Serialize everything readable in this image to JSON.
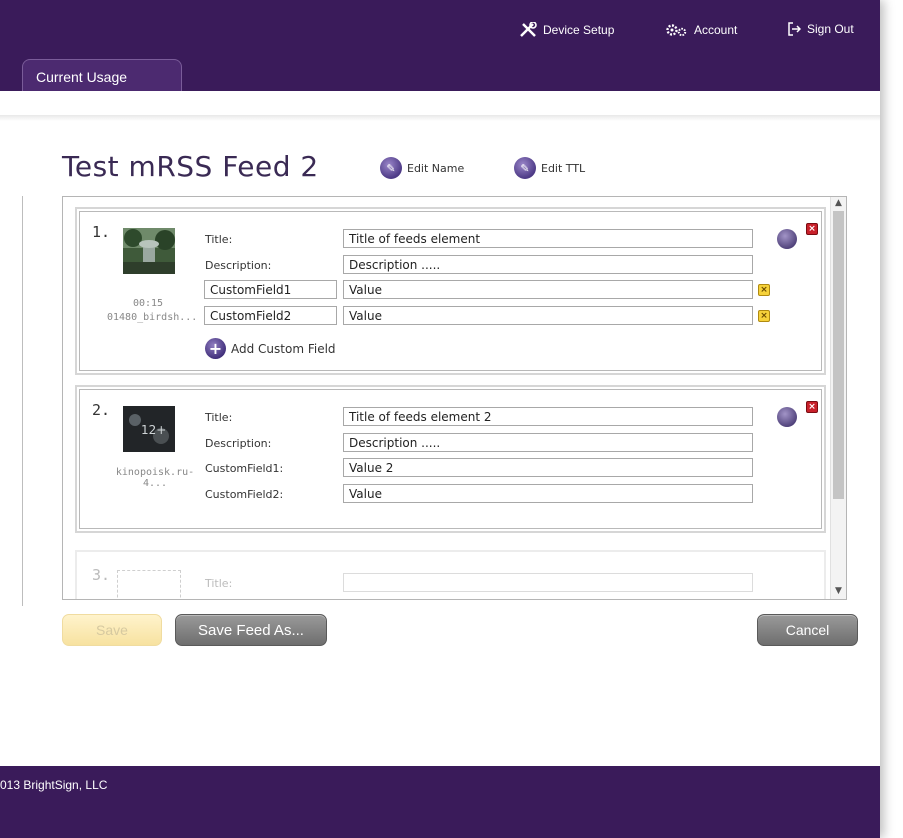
{
  "nav": {
    "device_setup": "Device Setup",
    "account": "Account",
    "sign_out": "Sign Out"
  },
  "tabs": {
    "current_usage": "Current Usage"
  },
  "page": {
    "title": "Test mRSS Feed 2",
    "edit_name": "Edit Name",
    "edit_ttl": "Edit TTL"
  },
  "items": [
    {
      "number": "1.",
      "duration": "00:15",
      "filename": "01480_birdsh...",
      "title_label": "Title:",
      "title_value": "Title of feeds element",
      "description_label": "Description:",
      "description_value": "Description .....",
      "custom_fields": [
        {
          "name": "CustomField1",
          "value": "Value"
        },
        {
          "name": "CustomField2",
          "value": "Value"
        }
      ],
      "add_custom_field": "Add Custom Field"
    },
    {
      "number": "2.",
      "filename": "kinopoisk.ru-4...",
      "title_label": "Title:",
      "title_value": "Title of feeds element 2",
      "description_label": "Description:",
      "description_value": "Description .....",
      "custom_fields": [
        {
          "name": "CustomField1:",
          "value": "Value 2"
        },
        {
          "name": "CustomField2:",
          "value": "Value"
        }
      ]
    },
    {
      "number": "3.",
      "title_label": "Title:",
      "title_value": ""
    }
  ],
  "buttons": {
    "save": "Save",
    "save_feed_as": "Save Feed As...",
    "cancel": "Cancel"
  },
  "footer": {
    "copyright": "013 BrightSign, LLC"
  },
  "colors": {
    "brand_purple": "#3a1b5a",
    "delete_red": "#c8202a",
    "remove_yellow": "#f6d23a"
  }
}
